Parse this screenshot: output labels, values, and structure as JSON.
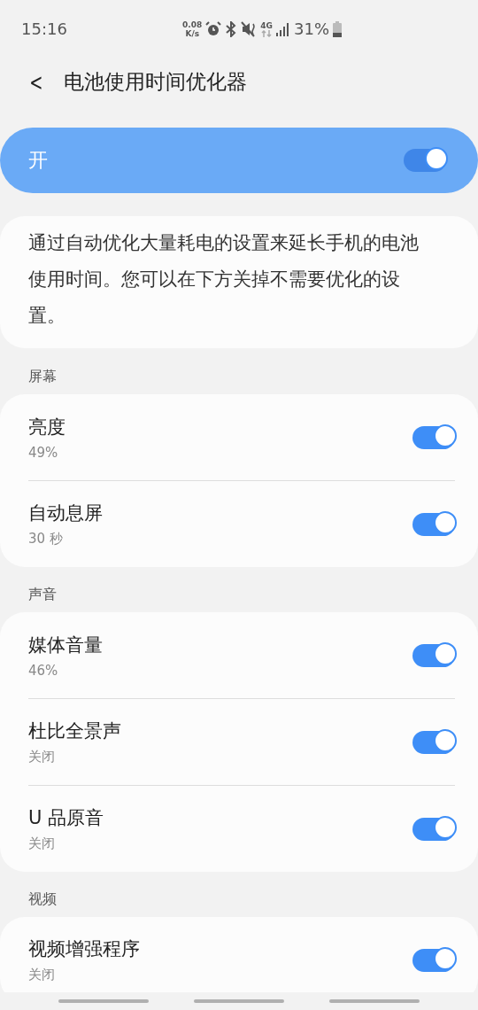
{
  "status_bar": {
    "time": "15:16",
    "net_speed_value": "0.08",
    "net_speed_unit": "K/s",
    "network": "4G",
    "battery": "31%"
  },
  "header": {
    "back": "<",
    "title": "电池使用时间优化器"
  },
  "master": {
    "label": "开",
    "on": true
  },
  "description": "通过自动优化大量耗电的设置来延长手机的电池使用时间。您可以在下方关掉不需要优化的设置。",
  "sections": [
    {
      "title": "屏幕",
      "items": [
        {
          "label": "亮度",
          "value": "49%",
          "on": true
        },
        {
          "label": "自动息屏",
          "value": "30 秒",
          "on": true
        }
      ]
    },
    {
      "title": "声音",
      "items": [
        {
          "label": "媒体音量",
          "value": "46%",
          "on": true
        },
        {
          "label": "杜比全景声",
          "value": "关闭",
          "on": true
        },
        {
          "label": "U 品原音",
          "value": "关闭",
          "on": true
        }
      ]
    },
    {
      "title": "视频",
      "items": [
        {
          "label": "视频增强程序",
          "value": "关闭",
          "on": true
        }
      ]
    }
  ]
}
